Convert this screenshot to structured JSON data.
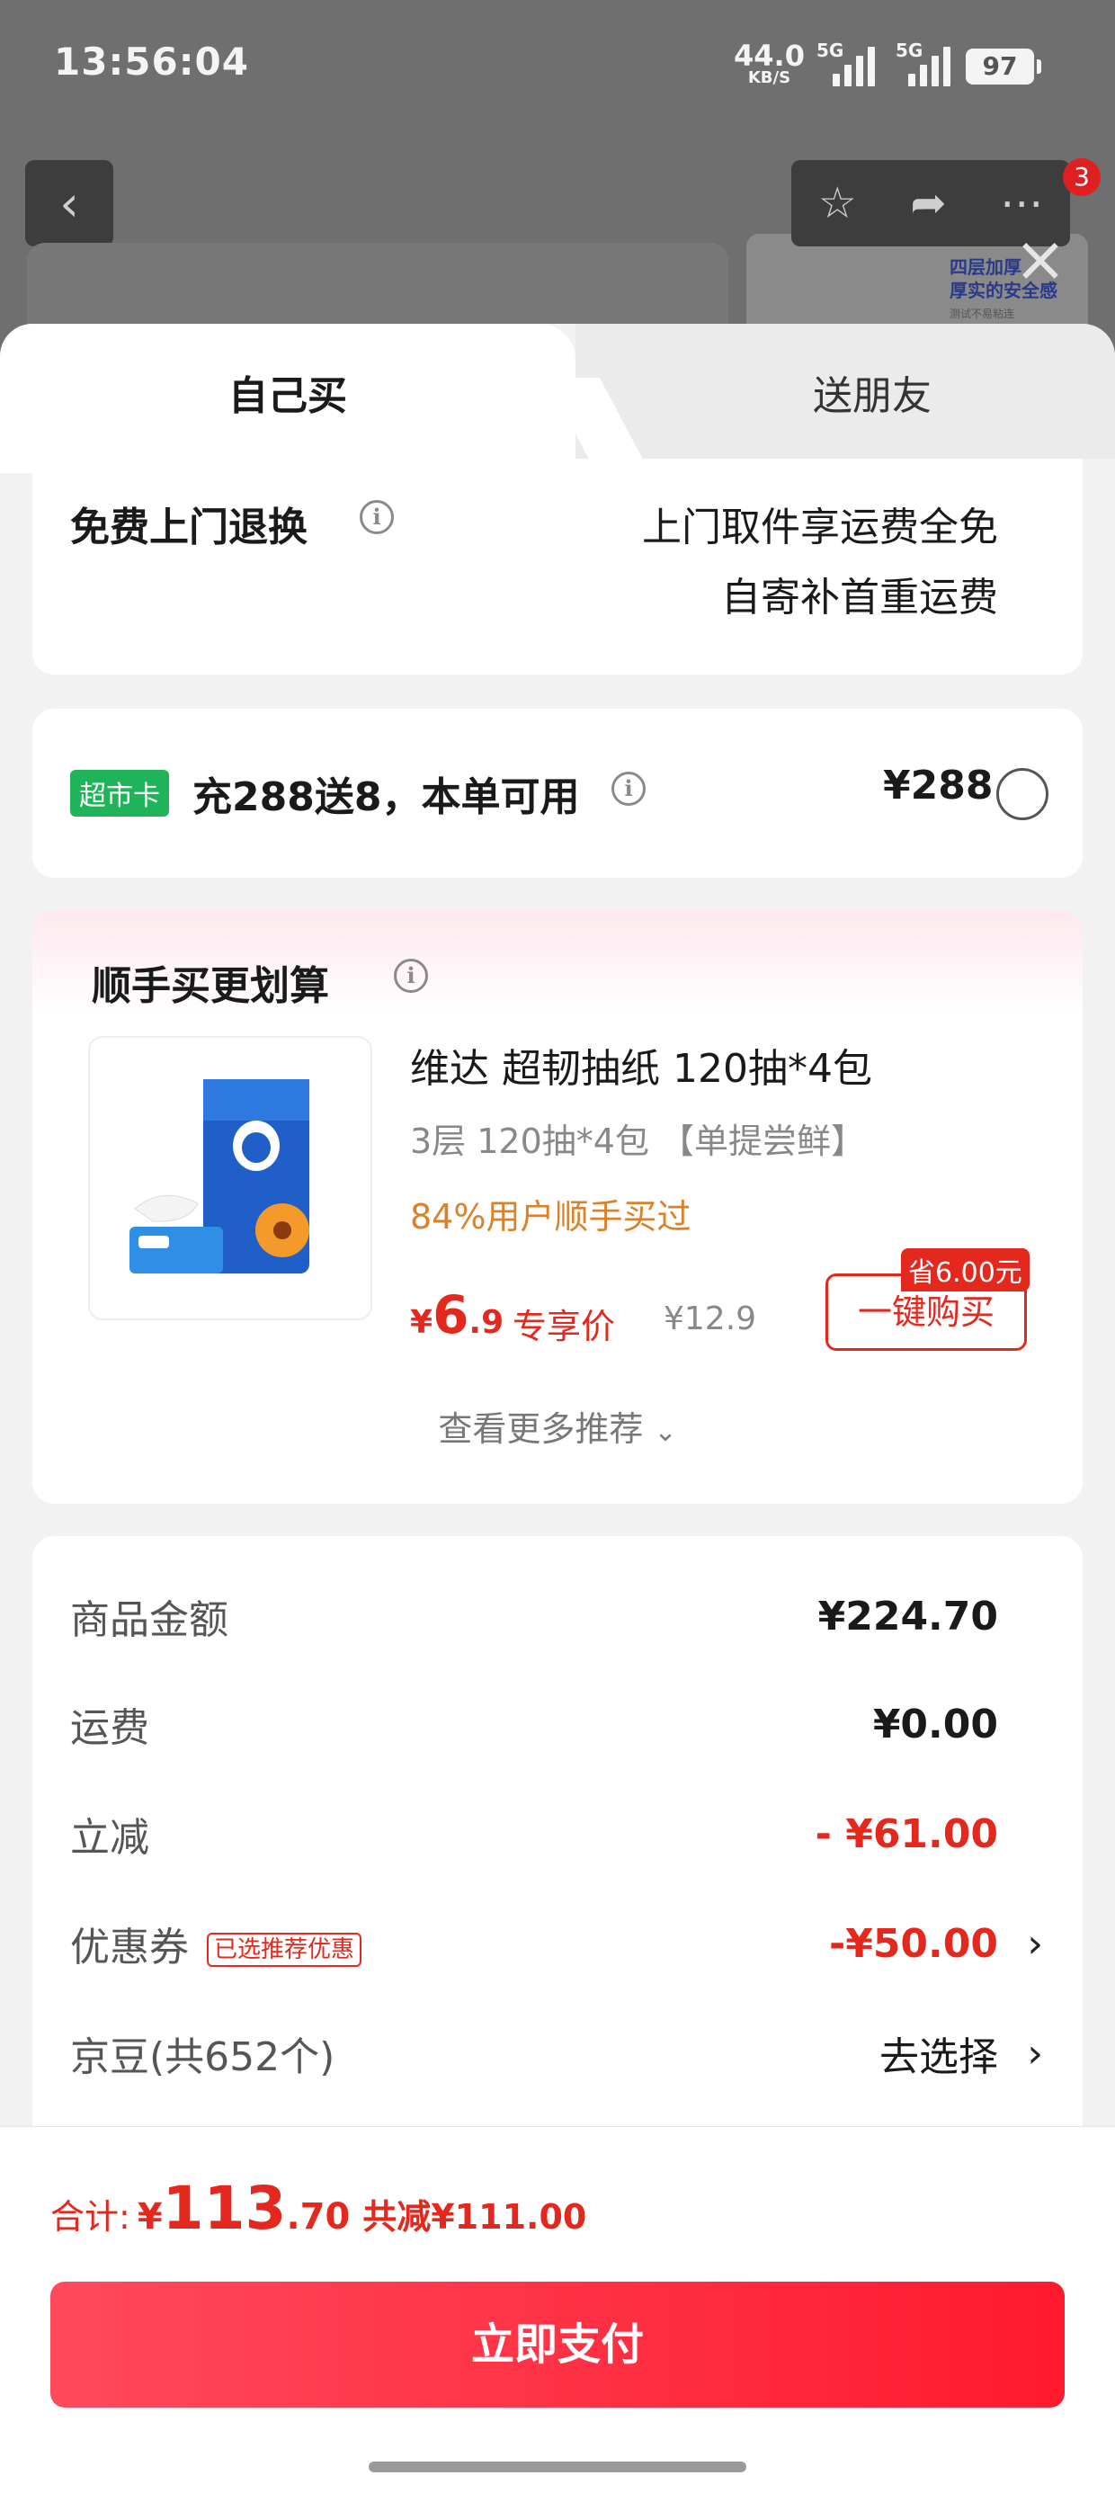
{
  "status": {
    "time": "13:56:04",
    "net_speed": "44.0",
    "net_unit": "KB/S",
    "signal1": "5G",
    "signal2": "5G",
    "battery": "97"
  },
  "nav": {
    "badge": "3"
  },
  "background_ad": {
    "line1": "四层加厚",
    "line2": "厚实的安全感",
    "small": "测试不易粘连"
  },
  "tabs": {
    "self": "自己买",
    "gift": "送朋友"
  },
  "return_service": {
    "title": "免费上门退换",
    "line1": "上门取件享运费全免",
    "line2": "自寄补首重运费"
  },
  "market_card": {
    "badge": "超市卡",
    "text": "充288送8，本单可用",
    "price": "¥288"
  },
  "recommend": {
    "title": "顺手买更划算",
    "product": {
      "name": "维达 超韧抽纸 120抽*4包",
      "spec": "3层 120抽*4包 【单提尝鲜】",
      "buyers": "84%用户顺手买过",
      "price_currency": "¥",
      "price_int": "6",
      "price_dec": ".9",
      "price_tag": "专享价",
      "orig_price": "¥12.9",
      "save_badge": "省6.00元",
      "buy_label": "一键购买"
    },
    "more": "查看更多推荐"
  },
  "summary": {
    "goods_label": "商品金额",
    "goods_value": "¥224.70",
    "shipping_label": "运费",
    "shipping_value": "¥0.00",
    "discount_label": "立减",
    "discount_value": "- ¥61.00",
    "coupon_label": "优惠券",
    "coupon_tag": "已选推荐优惠",
    "coupon_value": "-¥50.00",
    "beans_label": "京豆(共652个)",
    "beans_value": "去选择"
  },
  "footer": {
    "total_label": "合计:",
    "currency": "¥",
    "total_int": "113",
    "total_dec": ".70",
    "saved": "共减¥111.00",
    "pay_label": "立即支付"
  },
  "colors": {
    "accent_red": "#e4281e",
    "market_green": "#20b45a",
    "pay_gradient_start": "#ff4a5c",
    "pay_gradient_end": "#ff1a2e"
  },
  "icons": [
    "back-arrow-icon",
    "star-icon",
    "share-icon",
    "more-icon",
    "close-icon",
    "info-icon",
    "radio-icon",
    "chevron-right-icon",
    "chevron-down-icon"
  ]
}
